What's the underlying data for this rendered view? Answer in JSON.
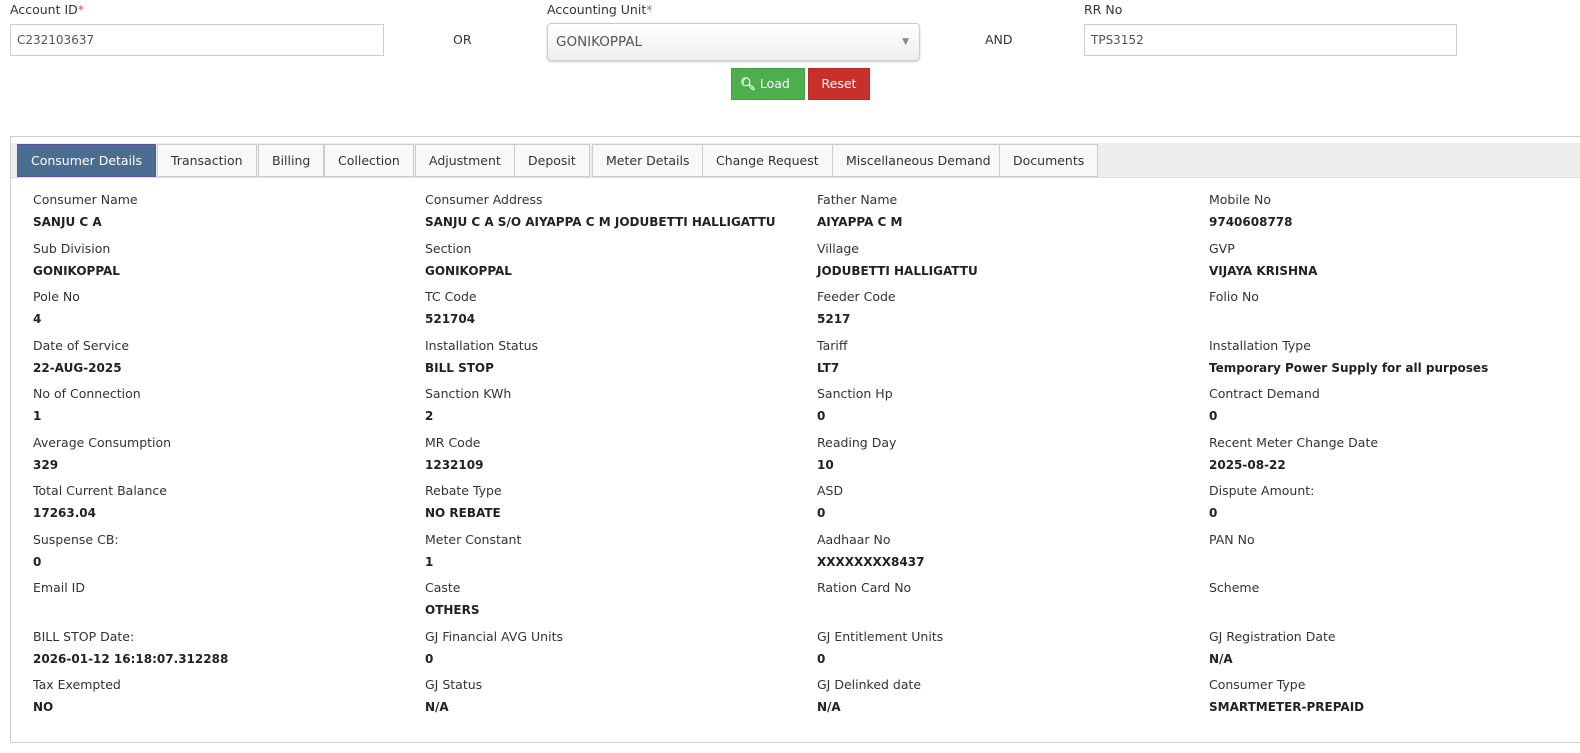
{
  "search": {
    "account_id_label": "Account ID",
    "account_id_value": "C232103637",
    "or_label": "OR",
    "accounting_unit_label": "Accounting Unit",
    "accounting_unit_value": "GONIKOPPAL",
    "and_label": "AND",
    "rr_no_label": "RR No",
    "rr_no_value": "TPS3152",
    "required_mark": "*",
    "load_label": "Load",
    "reset_label": "Reset",
    "colors": {
      "load": "#4cae4c",
      "reset": "#c9302c"
    }
  },
  "tabs": [
    "Consumer Details",
    "Transaction",
    "Billing",
    "Collection",
    "Adjustment",
    "Deposit",
    "Meter Details",
    "Change Request",
    "Miscellaneous Demand",
    "Documents"
  ],
  "active_tab": "Consumer Details",
  "fields": [
    [
      "Consumer Name",
      "SANJU C A"
    ],
    [
      "Consumer Address",
      "SANJU C A S/O AIYAPPA C M JODUBETTI HALLIGATTU"
    ],
    [
      "Father Name",
      "AIYAPPA C M"
    ],
    [
      "Mobile No",
      "9740608778"
    ],
    [
      "Sub Division",
      "GONIKOPPAL"
    ],
    [
      "Section",
      "GONIKOPPAL"
    ],
    [
      "Village",
      "JODUBETTI HALLIGATTU"
    ],
    [
      "GVP",
      "VIJAYA KRISHNA"
    ],
    [
      "Pole No",
      "4"
    ],
    [
      "TC Code",
      "521704"
    ],
    [
      "Feeder Code",
      "5217"
    ],
    [
      "Folio No",
      ""
    ],
    [
      "Date of Service",
      "22-AUG-2025"
    ],
    [
      "Installation Status",
      "BILL STOP"
    ],
    [
      "Tariff",
      "LT7"
    ],
    [
      "Installation Type",
      "Temporary Power Supply for all purposes"
    ],
    [
      "No of Connection",
      "1"
    ],
    [
      "Sanction KWh",
      "2"
    ],
    [
      "Sanction Hp",
      "0"
    ],
    [
      "Contract Demand",
      "0"
    ],
    [
      "Average Consumption",
      "329"
    ],
    [
      "MR Code",
      "1232109"
    ],
    [
      "Reading Day",
      "10"
    ],
    [
      "Recent Meter Change Date",
      "2025-08-22"
    ],
    [
      "Total Current Balance",
      "17263.04"
    ],
    [
      "Rebate Type",
      "NO REBATE"
    ],
    [
      "ASD",
      "0"
    ],
    [
      "Dispute Amount:",
      "0"
    ],
    [
      "Suspense CB:",
      "0"
    ],
    [
      "Meter Constant",
      "1"
    ],
    [
      "Aadhaar No",
      "XXXXXXXX8437"
    ],
    [
      "PAN No",
      ""
    ],
    [
      "Email ID",
      ""
    ],
    [
      "Caste",
      "OTHERS"
    ],
    [
      "Ration Card No",
      ""
    ],
    [
      "Scheme",
      ""
    ],
    [
      "BILL STOP Date:",
      "2026-01-12 16:18:07.312288"
    ],
    [
      "GJ Financial AVG Units",
      "0"
    ],
    [
      "GJ Entitlement Units",
      "0"
    ],
    [
      "GJ Registration Date",
      "N/A"
    ],
    [
      "Tax Exempted",
      "NO"
    ],
    [
      "GJ Status",
      "N/A"
    ],
    [
      "GJ Delinked date",
      "N/A"
    ],
    [
      "Consumer Type",
      "SMARTMETER-PREPAID"
    ]
  ]
}
